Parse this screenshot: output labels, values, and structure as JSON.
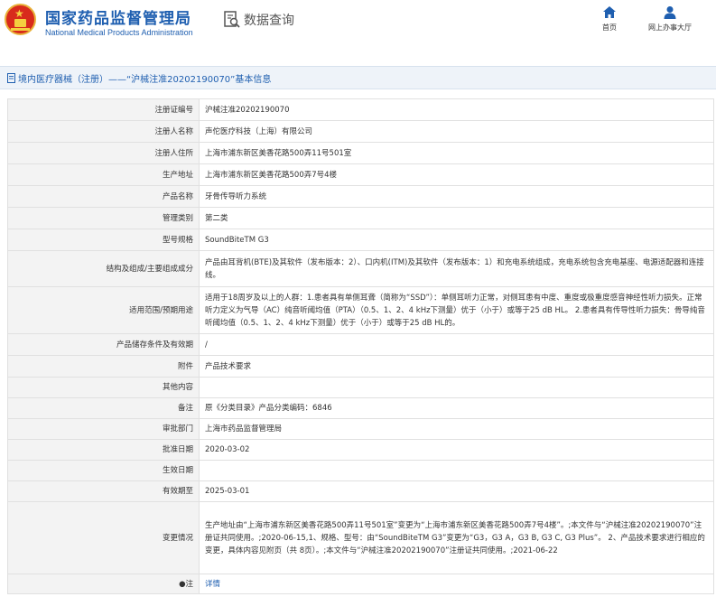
{
  "header": {
    "org_name_cn": "国家药品监督管理局",
    "org_name_en": "National Medical Products Administration",
    "query_label": "数据查询",
    "nav": {
      "home": "首页",
      "online": "网上办事大厅"
    }
  },
  "title": "境内医疗器械（注册）——“沪械注准20202190070”基本信息",
  "rows": [
    {
      "label": "注册证编号",
      "value": "沪械注准20202190070"
    },
    {
      "label": "注册人名称",
      "value": "声佗医疗科技（上海）有限公司"
    },
    {
      "label": "注册人住所",
      "value": "上海市浦东新区美香花路500弄11号501室"
    },
    {
      "label": "生产地址",
      "value": "上海市浦东新区美香花路500弄7号4楼"
    },
    {
      "label": "产品名称",
      "value": "牙骨传导听力系统"
    },
    {
      "label": "管理类别",
      "value": "第二类"
    },
    {
      "label": "型号规格",
      "value": "SoundBiteTM G3"
    },
    {
      "label": "结构及组成/主要组成成分",
      "value": "产品由耳背机(BTE)及其软件（发布版本：2）、口内机(ITM)及其软件（发布版本：1）和充电系统组成，充电系统包含充电基座、电源适配器和连接线。"
    },
    {
      "label": "适用范围/预期用途",
      "value": "适用于18周岁及以上的人群：1.患者具有单侧耳聋（简称为“SSD”）：单侧耳听力正常，对侧耳患有中度、重度或极重度感音神经性听力损失。正常听力定义为气导（AC）纯音听阈均值（PTA）（0.5、1、2、4 kHz下测量）优于（小于）或等于25 dB HL。 2.患者具有传导性听力损失：骨导纯音听阈均值（0.5、1、2、4 kHz下测量）优于（小于）或等于25 dB HL的。"
    },
    {
      "label": "产品储存条件及有效期",
      "value": "/"
    },
    {
      "label": "附件",
      "value": "产品技术要求"
    },
    {
      "label": "其他内容",
      "value": ""
    },
    {
      "label": "备注",
      "value": "原《分类目录》产品分类编码：6846"
    },
    {
      "label": "审批部门",
      "value": "上海市药品监督管理局"
    },
    {
      "label": "批准日期",
      "value": "2020-03-02"
    },
    {
      "label": "生效日期",
      "value": ""
    },
    {
      "label": "有效期至",
      "value": "2025-03-01"
    },
    {
      "label": "变更情况",
      "value": "生产地址由“上海市浦东新区美香花路500弄11号501室”变更为“上海市浦东新区美香花路500弄7号4楼”。;本文件与“沪械注准20202190070”注册证共同使用。;2020-06-15,1、规格、型号：由“SoundBiteTM G3”变更为“G3，G3 A，G3 B, G3 C, G3 Plus”。 2、产品技术要求进行相应的变更，具体内容见附页（共 8页）。;本文件与“沪械注准20202190070”注册证共同使用。;2021-06-22"
    },
    {
      "label": "●注",
      "value": "详情"
    }
  ]
}
